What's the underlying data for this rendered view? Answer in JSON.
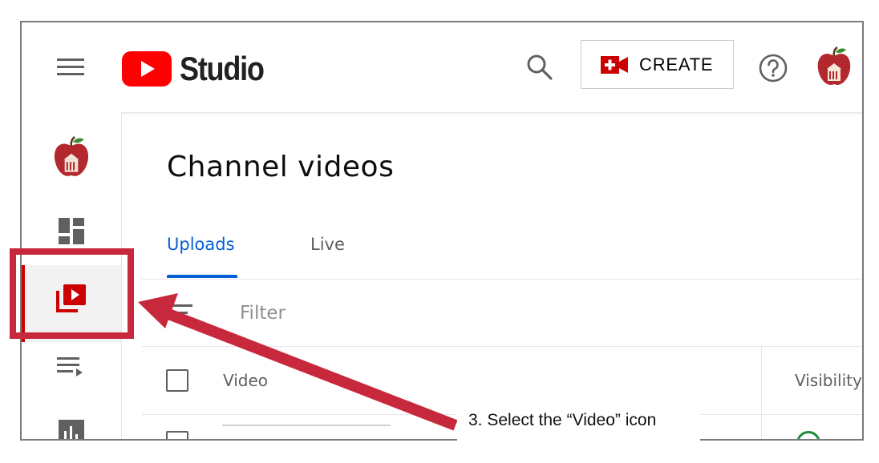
{
  "app": {
    "brand_name": "Studio",
    "colors": {
      "brand_red": "#ff0000",
      "accent_blue": "#065fd4",
      "annotation_red": "#c8283c"
    }
  },
  "header": {
    "create_label": "CREATE",
    "icons": [
      "menu-icon",
      "youtube-play-icon",
      "search-icon",
      "create-video-icon",
      "help-icon",
      "channel-avatar-icon"
    ]
  },
  "sidebar": {
    "items": [
      {
        "icon": "channel-avatar-icon"
      },
      {
        "icon": "dashboard-icon"
      },
      {
        "icon": "videos-icon",
        "active": true
      },
      {
        "icon": "playlists-icon"
      },
      {
        "icon": "analytics-icon"
      }
    ]
  },
  "main": {
    "title": "Channel videos",
    "tabs": [
      {
        "label": "Uploads",
        "active": true
      },
      {
        "label": "Live",
        "active": false
      }
    ],
    "filter": {
      "placeholder": "Filter"
    },
    "table": {
      "columns": [
        "Video",
        "Visibility"
      ]
    }
  },
  "annotation": {
    "callout": "3. Select the “Video” icon"
  }
}
